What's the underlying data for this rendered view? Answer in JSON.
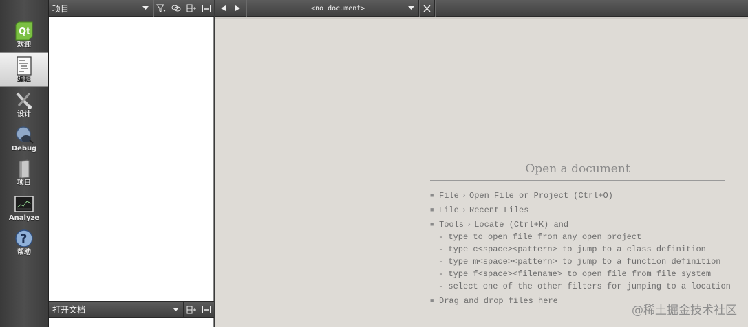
{
  "modes": [
    {
      "label": "欢迎",
      "icon": "qt-logo-icon",
      "active": false
    },
    {
      "label": "编辑",
      "icon": "edit-document-icon",
      "active": true
    },
    {
      "label": "设计",
      "icon": "design-tools-icon",
      "active": false
    },
    {
      "label": "Debug",
      "icon": "debug-bug-icon",
      "active": false
    },
    {
      "label": "项目",
      "icon": "project-book-icon",
      "active": false
    },
    {
      "label": "Analyze",
      "icon": "analyze-monitor-icon",
      "active": false
    },
    {
      "label": "帮助",
      "icon": "help-question-icon",
      "active": false
    }
  ],
  "projects_panel": {
    "title": "项目"
  },
  "open_docs_panel": {
    "title": "打开文档"
  },
  "editor": {
    "document_combo": "<no document>"
  },
  "welcome": {
    "heading": "Open a document",
    "items": [
      {
        "parts": [
          "File",
          "Open File or Project (Ctrl+O)"
        ]
      },
      {
        "parts": [
          "File",
          "Recent Files"
        ]
      },
      {
        "parts": [
          "Tools",
          "Locate (Ctrl+K) and"
        ]
      }
    ],
    "sub_items": [
      "- type to open file from any open project",
      "- type c<space><pattern> to jump to a class definition",
      "- type m<space><pattern> to jump to a function definition",
      "- type f<space><filename> to open file from file system",
      "- select one of the other filters for jumping to a location"
    ],
    "drag_drop": "Drag and drop files here"
  },
  "watermark": "@稀土掘金技术社区",
  "colors": {
    "sidebar": "#4a4a4a",
    "toolbar": "#4d4d4d",
    "editor_bg": "#dedbd6",
    "welcome_text": "#6e6e6e"
  }
}
